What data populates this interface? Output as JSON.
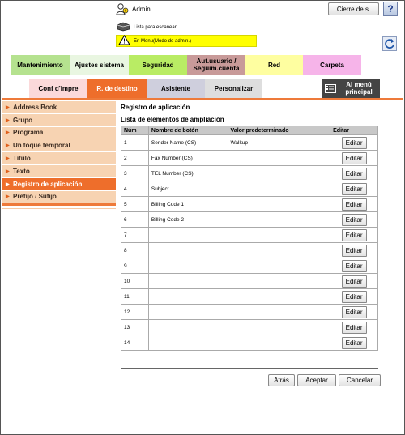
{
  "header": {
    "user_label": "Admin.",
    "logout_label": "Cierre de s.",
    "help_label": "?",
    "scan_list_label": "Lista para escanear",
    "mode_label": "En Menu(Modo de admin.)"
  },
  "tabs_top": [
    {
      "label": "Mantenimiento",
      "color": "#b5e28f"
    },
    {
      "label": "Ajustes sistema",
      "color": "#e9f6e1"
    },
    {
      "label": "Seguridad",
      "color": "#b9ec64"
    },
    {
      "label": "Aut.usuario / Seguim.cuenta",
      "color": "#c89a99"
    },
    {
      "label": "Red",
      "color": "#fefea0"
    },
    {
      "label": "Carpeta",
      "color": "#f6b4e9"
    }
  ],
  "tabs_sub": [
    {
      "label": "Conf d'impre",
      "color": "#fbd9da"
    },
    {
      "label": "R. de destino",
      "color": "#ee6e2b",
      "active": true
    },
    {
      "label": "Asistente",
      "color": "#cfcfdd"
    },
    {
      "label": "Personalizar",
      "color": "#dedede"
    }
  ],
  "menu_button_label": "Al menú principal",
  "sidebar": {
    "items": [
      {
        "label": "Address Book"
      },
      {
        "label": "Grupo"
      },
      {
        "label": "Programa"
      },
      {
        "label": "Un toque temporal"
      },
      {
        "label": "Título"
      },
      {
        "label": "Texto"
      },
      {
        "label": "Registro de aplicación",
        "active": true
      },
      {
        "label": "Prefijo / Sufijo"
      }
    ]
  },
  "main": {
    "page_title": "Registro de aplicación",
    "section_title": "Lista de elementos de ampliación",
    "columns": [
      "Núm",
      "Nombre de botón",
      "Valor predeterminado",
      "Editar"
    ],
    "edit_label": "Editar",
    "rows": [
      {
        "num": "1",
        "name": "Sender Name (CS)",
        "default": "Walkup"
      },
      {
        "num": "2",
        "name": "Fax Number (CS)",
        "default": ""
      },
      {
        "num": "3",
        "name": "TEL Number (CS)",
        "default": ""
      },
      {
        "num": "4",
        "name": "Subject",
        "default": ""
      },
      {
        "num": "5",
        "name": "Billing Code 1",
        "default": ""
      },
      {
        "num": "6",
        "name": "Billing Code 2",
        "default": ""
      },
      {
        "num": "7",
        "name": "",
        "default": ""
      },
      {
        "num": "8",
        "name": "",
        "default": ""
      },
      {
        "num": "9",
        "name": "",
        "default": ""
      },
      {
        "num": "10",
        "name": "",
        "default": ""
      },
      {
        "num": "11",
        "name": "",
        "default": ""
      },
      {
        "num": "12",
        "name": "",
        "default": ""
      },
      {
        "num": "13",
        "name": "",
        "default": ""
      },
      {
        "num": "14",
        "name": "",
        "default": ""
      }
    ]
  },
  "footer": {
    "back_label": "Atrás",
    "accept_label": "Aceptar",
    "cancel_label": "Cancelar"
  }
}
